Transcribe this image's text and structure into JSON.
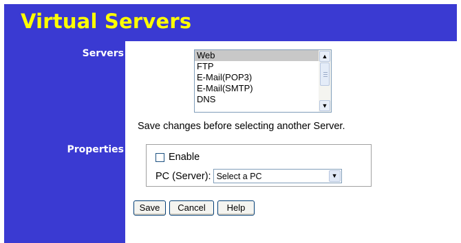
{
  "page": {
    "title": "Virtual Servers"
  },
  "labels": {
    "servers": "Servers",
    "properties": "Properties"
  },
  "servers": {
    "items": [
      "Web",
      "FTP",
      "E-Mail(POP3)",
      "E-Mail(SMTP)",
      "DNS"
    ],
    "selected": "Web"
  },
  "note": "Save changes before selecting another Server.",
  "properties": {
    "enable_label": "Enable",
    "enable_checked": false,
    "pc_label": "PC (Server):",
    "pc_selected": "Select a PC"
  },
  "buttons": {
    "save": "Save",
    "cancel": "Cancel",
    "help": "Help"
  },
  "colors": {
    "header_bg": "#3a3ad2",
    "title_text": "#ffff00",
    "label_text": "#ffffff"
  }
}
